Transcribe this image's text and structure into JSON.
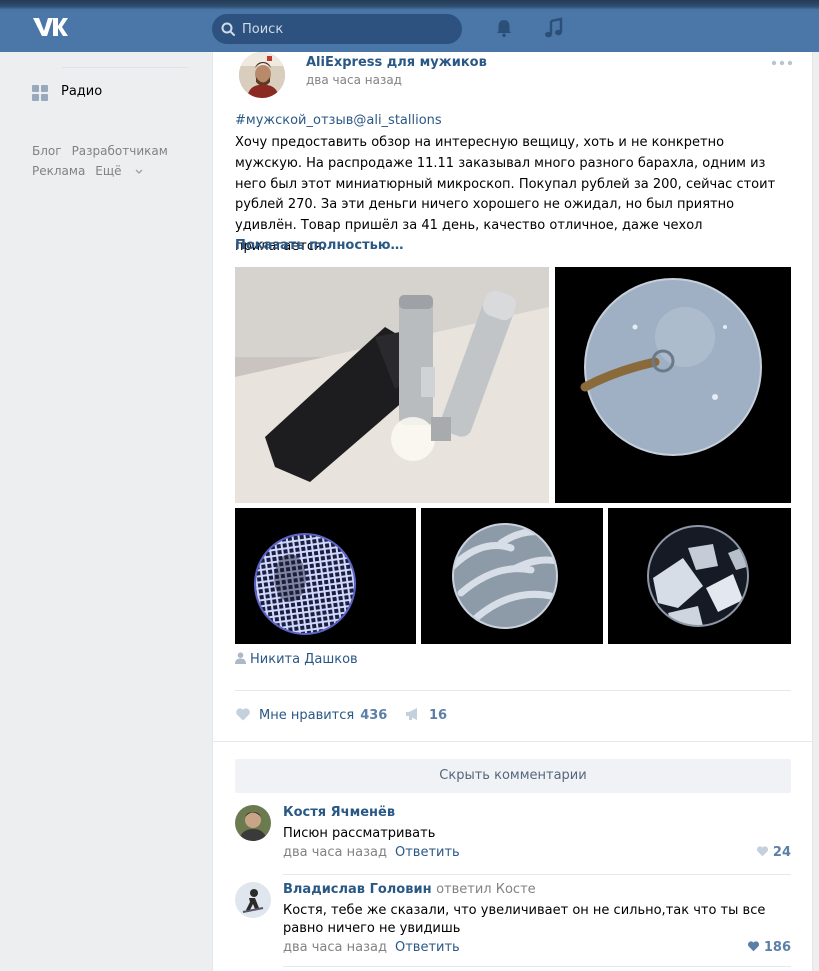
{
  "header": {
    "search_placeholder": "Поиск"
  },
  "sidebar": {
    "radio_label": "Радио",
    "footer": {
      "links": [
        "Блог",
        "Разработчикам",
        "Реклама",
        "Ещё"
      ]
    }
  },
  "post": {
    "author": "AliExpress для мужиков",
    "time": "два часа назад",
    "hashtag": "#мужской_отзыв@ali_stallions",
    "text": "Хочу предоставить обзор на интересную вещицу, хоть и не конкретно мужскую. На распродаже 11.11 заказывал много разного барахла, одним из него был этот миниатюрный микроскоп. Покупал рублей за 200, сейчас стоит рублей 270. За эти деньги ничего хорошего не ожидал, но был приятно удивлён. Товар пришёл за 41 день, качество отличное, даже чехол прилагается.",
    "show_more": "Показать полностью…",
    "signed_by": "Никита Дашков",
    "like_label": "Мне нравится",
    "likes": "436",
    "shares": "16",
    "hide_comments": "Скрыть комментарии"
  },
  "comments": [
    {
      "name": "Костя Ячменёв",
      "replied": "",
      "text": "Писюн рассматривать",
      "time": "два часа назад",
      "reply_label": "Ответить",
      "likes": "24"
    },
    {
      "name": "Владислав Головин",
      "replied": "ответил Косте",
      "text": "Костя, тебе же сказали, что увеличивает он не сильно,так что ты все равно ничего не увидишь",
      "time": "два часа назад",
      "reply_label": "Ответить",
      "likes": "186"
    }
  ],
  "colors": {
    "header": "#4a76a8",
    "link": "#2a5885",
    "muted": "#828282",
    "background": "#edeef0"
  }
}
